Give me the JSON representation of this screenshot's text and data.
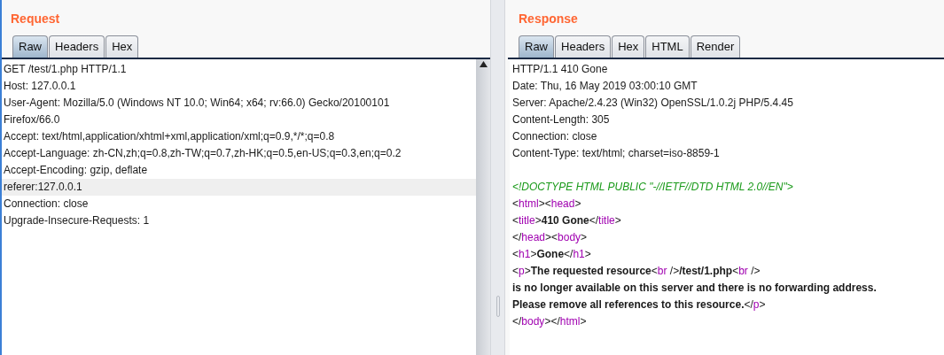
{
  "request": {
    "title": "Request",
    "tabs": [
      {
        "label": "Raw",
        "selected": true
      },
      {
        "label": "Headers",
        "selected": false
      },
      {
        "label": "Hex",
        "selected": false
      }
    ],
    "lines": [
      {
        "text": "GET /test/1.php HTTP/1.1",
        "highlighted": false
      },
      {
        "text": "Host: 127.0.0.1",
        "highlighted": false
      },
      {
        "text": "User-Agent: Mozilla/5.0 (Windows NT 10.0; Win64; x64; rv:66.0) Gecko/20100101",
        "highlighted": false
      },
      {
        "text": "Firefox/66.0",
        "highlighted": false
      },
      {
        "text": "Accept: text/html,application/xhtml+xml,application/xml;q=0.9,*/*;q=0.8",
        "highlighted": false
      },
      {
        "text": "Accept-Language: zh-CN,zh;q=0.8,zh-TW;q=0.7,zh-HK;q=0.5,en-US;q=0.3,en;q=0.2",
        "highlighted": false
      },
      {
        "text": "Accept-Encoding: gzip, deflate",
        "highlighted": false
      },
      {
        "text": "referer:127.0.0.1",
        "highlighted": true
      },
      {
        "text": "Connection: close",
        "highlighted": false
      },
      {
        "text": "Upgrade-Insecure-Requests: 1",
        "highlighted": false
      }
    ]
  },
  "response": {
    "title": "Response",
    "tabs": [
      {
        "label": "Raw",
        "selected": true
      },
      {
        "label": "Headers",
        "selected": false
      },
      {
        "label": "Hex",
        "selected": false
      },
      {
        "label": "HTML",
        "selected": false
      },
      {
        "label": "Render",
        "selected": false
      }
    ],
    "headers": [
      [
        {
          "kind": "plain",
          "text": "HTTP/1.1 410 Gone"
        }
      ],
      [
        {
          "kind": "plain",
          "text": "Date: Thu, 16 May 2019 03:00:10 GMT"
        }
      ],
      [
        {
          "kind": "plain",
          "text": "Server: Apache/2.4.23 (Win32) OpenSSL/1.0.2j PHP/5.4.45"
        }
      ],
      [
        {
          "kind": "plain",
          "text": "Content-Length: 305"
        }
      ],
      [
        {
          "kind": "plain",
          "text": "Connection: close"
        }
      ],
      [
        {
          "kind": "plain",
          "text": "Content-Type: text/html; charset=iso-8859-1"
        }
      ]
    ],
    "body": [
      [
        {
          "kind": "doctype",
          "text": "<!DOCTYPE HTML PUBLIC \"-//IETF//DTD HTML 2.0//EN\">"
        }
      ],
      [
        {
          "kind": "punct",
          "text": "<"
        },
        {
          "kind": "tag",
          "text": "html"
        },
        {
          "kind": "punct",
          "text": "><"
        },
        {
          "kind": "tag",
          "text": "head"
        },
        {
          "kind": "punct",
          "text": ">"
        }
      ],
      [
        {
          "kind": "punct",
          "text": "<"
        },
        {
          "kind": "tag",
          "text": "title"
        },
        {
          "kind": "punct",
          "text": ">"
        },
        {
          "kind": "bold",
          "text": "410 Gone"
        },
        {
          "kind": "punct",
          "text": "</"
        },
        {
          "kind": "tag",
          "text": "title"
        },
        {
          "kind": "punct",
          "text": ">"
        }
      ],
      [
        {
          "kind": "punct",
          "text": "</"
        },
        {
          "kind": "tag",
          "text": "head"
        },
        {
          "kind": "punct",
          "text": "><"
        },
        {
          "kind": "tag",
          "text": "body"
        },
        {
          "kind": "punct",
          "text": ">"
        }
      ],
      [
        {
          "kind": "punct",
          "text": "<"
        },
        {
          "kind": "tag",
          "text": "h1"
        },
        {
          "kind": "punct",
          "text": ">"
        },
        {
          "kind": "bold",
          "text": "Gone"
        },
        {
          "kind": "punct",
          "text": "</"
        },
        {
          "kind": "tag",
          "text": "h1"
        },
        {
          "kind": "punct",
          "text": ">"
        }
      ],
      [
        {
          "kind": "punct",
          "text": "<"
        },
        {
          "kind": "tag",
          "text": "p"
        },
        {
          "kind": "punct",
          "text": ">"
        },
        {
          "kind": "bold",
          "text": "The requested resource"
        },
        {
          "kind": "punct",
          "text": "<"
        },
        {
          "kind": "tag",
          "text": "br"
        },
        {
          "kind": "punct",
          "text": " />"
        },
        {
          "kind": "bold",
          "text": "/test/1.php"
        },
        {
          "kind": "punct",
          "text": "<"
        },
        {
          "kind": "tag",
          "text": "br"
        },
        {
          "kind": "punct",
          "text": " />"
        }
      ],
      [
        {
          "kind": "bold",
          "text": "is no longer available on this server and there is no forwarding address."
        }
      ],
      [
        {
          "kind": "bold",
          "text": "Please remove all references to this resource."
        },
        {
          "kind": "punct",
          "text": "</"
        },
        {
          "kind": "tag",
          "text": "p"
        },
        {
          "kind": "punct",
          "text": ">"
        }
      ],
      [
        {
          "kind": "punct",
          "text": "</"
        },
        {
          "kind": "tag",
          "text": "body"
        },
        {
          "kind": "punct",
          "text": "></"
        },
        {
          "kind": "tag",
          "text": "html"
        },
        {
          "kind": "punct",
          "text": ">"
        }
      ]
    ]
  }
}
